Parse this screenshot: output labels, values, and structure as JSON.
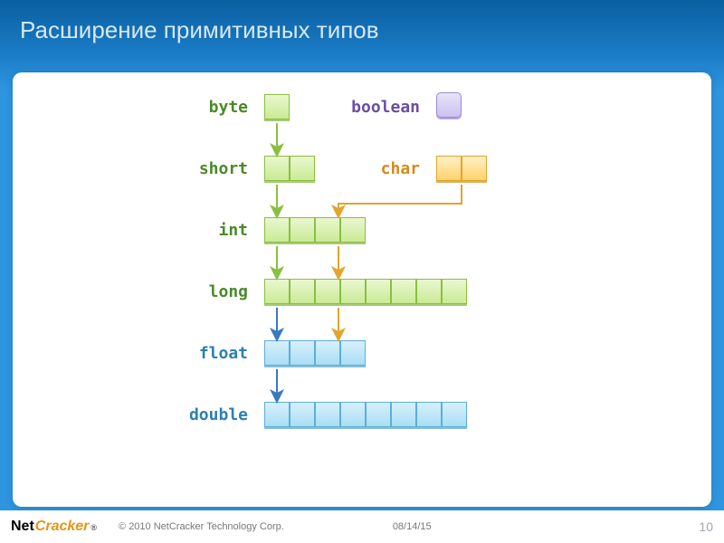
{
  "title": "Расширение примитивных типов",
  "types": {
    "byte": {
      "label": "byte",
      "color": "#4a8a2a",
      "cells": 1,
      "scheme": "green"
    },
    "boolean": {
      "label": "boolean",
      "color": "#6a4fa0",
      "cells": 1,
      "scheme": "purple"
    },
    "short": {
      "label": "short",
      "color": "#4a8a2a",
      "cells": 2,
      "scheme": "green"
    },
    "char": {
      "label": "char",
      "color": "#d28a1e",
      "cells": 2,
      "scheme": "yellow"
    },
    "int": {
      "label": "int",
      "color": "#4a8a2a",
      "cells": 4,
      "scheme": "green"
    },
    "long": {
      "label": "long",
      "color": "#4a8a2a",
      "cells": 8,
      "scheme": "green"
    },
    "float": {
      "label": "float",
      "color": "#2e7fb0",
      "cells": 4,
      "scheme": "blue"
    },
    "double": {
      "label": "double",
      "color": "#2e7fb0",
      "cells": 8,
      "scheme": "blue"
    }
  },
  "arrows": [
    {
      "from": "byte",
      "to": "short",
      "color": "#8bbf3f"
    },
    {
      "from": "short",
      "to": "int",
      "color": "#8bbf3f"
    },
    {
      "from": "char",
      "to": "int",
      "color": "#e2a52e"
    },
    {
      "from": "int",
      "to": "long",
      "color": "#8bbf3f"
    },
    {
      "from": "int",
      "to": "long_via_char_col",
      "color": "#e2a52e"
    },
    {
      "from": "long",
      "to": "float",
      "color": "#3a79c0"
    },
    {
      "from": "long",
      "to": "float_via_char_col",
      "color": "#e2a52e"
    },
    {
      "from": "float",
      "to": "double",
      "color": "#3a79c0"
    }
  ],
  "footer": {
    "logo_net": "Net",
    "logo_cracker": "Cracker",
    "logo_reg": "®",
    "copyright": "© 2010 NetCracker Technology Corp.",
    "date": "08/14/15",
    "page": "10"
  }
}
